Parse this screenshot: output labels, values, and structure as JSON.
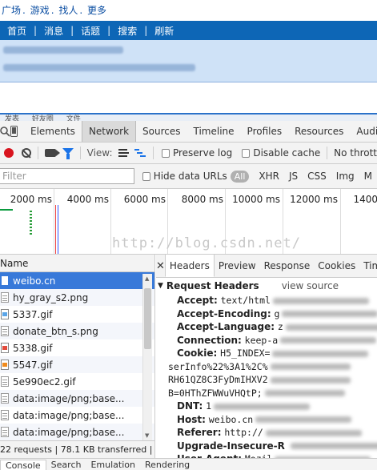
{
  "page": {
    "top_links": [
      "广场",
      "游戏",
      "找人",
      "更多"
    ],
    "nav": [
      "首页",
      "消息",
      "话题",
      "搜索",
      "刷新"
    ],
    "tabs_partial": [
      "发表",
      "好友圈",
      "文件"
    ]
  },
  "devtools": {
    "tabs": [
      "Elements",
      "Network",
      "Sources",
      "Timeline",
      "Profiles",
      "Resources",
      "Audits"
    ],
    "selected_tab": "Network",
    "toolbar": {
      "view_label": "View:",
      "preserve_log": "Preserve log",
      "disable_cache": "Disable cache",
      "throttle": "No thrott"
    },
    "filter": {
      "placeholder": "Filter",
      "hide_data_urls": "Hide data URLs",
      "types": [
        "All",
        "XHR",
        "JS",
        "CSS",
        "Img",
        "M"
      ]
    },
    "overview": {
      "ticks": [
        "2000 ms",
        "4000 ms",
        "6000 ms",
        "8000 ms",
        "10000 ms",
        "12000 ms",
        "1400"
      ],
      "watermark": "http://blog.csdn.net/"
    },
    "requests": {
      "header": "Name",
      "items": [
        {
          "name": "weibo.cn",
          "type": "doc"
        },
        {
          "name": "hy_gray_s2.png",
          "type": "blank"
        },
        {
          "name": "5337.gif",
          "type": "img"
        },
        {
          "name": "donate_btn_s.png",
          "type": "blank"
        },
        {
          "name": "5338.gif",
          "type": "img-red"
        },
        {
          "name": "5547.gif",
          "type": "img-orange"
        },
        {
          "name": "5e990ec2.gif",
          "type": "blank"
        },
        {
          "name": "data:image/png;base...",
          "type": "blank"
        },
        {
          "name": "data:image/png;base...",
          "type": "blank"
        },
        {
          "name": "data:image/png;base...",
          "type": "blank"
        }
      ],
      "status": "22 requests  |  78.1 KB transferred  |"
    },
    "detail": {
      "tabs": [
        "Headers",
        "Preview",
        "Response",
        "Cookies",
        "Timing"
      ],
      "section_title": "Request Headers",
      "view_source": "view source",
      "headers": [
        {
          "key": "Accept:",
          "value": "text/html"
        },
        {
          "key": "Accept-Encoding:",
          "value": "g"
        },
        {
          "key": "Accept-Language:",
          "value": "z"
        },
        {
          "key": "Connection:",
          "value": "keep-a"
        },
        {
          "key": "Cookie:",
          "value": "H5_INDEX="
        }
      ],
      "cookie_lines": [
        "serInfo%22%3A1%2C%",
        "RH61QZ8C3FyDmIHXV2",
        "B=0HThZFWWuVHQtP;"
      ],
      "headers_after": [
        {
          "key": "DNT:",
          "value": "1"
        },
        {
          "key": "Host:",
          "value": "weibo.cn"
        },
        {
          "key": "Referer:",
          "value": "http://"
        },
        {
          "key": "Upgrade-Insecure-R",
          "value": ""
        },
        {
          "key": "User-Agent:",
          "value": "Mozil"
        }
      ]
    },
    "drawer_tabs": [
      "Console",
      "Search",
      "Emulation",
      "Rendering"
    ]
  }
}
